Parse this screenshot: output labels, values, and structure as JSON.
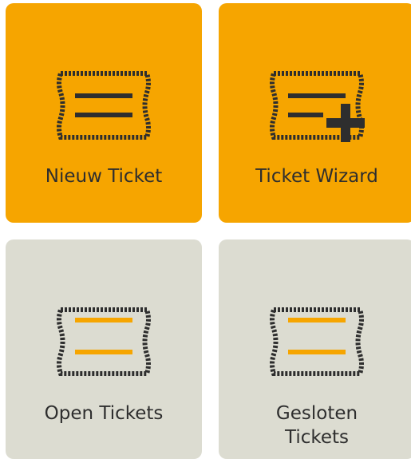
{
  "tiles": [
    {
      "label": "Nieuw Ticket",
      "icon": "ticket-icon",
      "color": "#f6a500"
    },
    {
      "label": "Ticket Wizard",
      "icon": "ticket-add-icon",
      "color": "#f6a500"
    },
    {
      "label": "Open Tickets",
      "icon": "ticket-icon",
      "color": "#dcdcd1"
    },
    {
      "label": "Gesloten Tickets",
      "label_line1": "Gesloten",
      "label_line2": "Tickets",
      "icon": "ticket-icon",
      "color": "#dcdcd1"
    }
  ],
  "colors": {
    "accent": "#f6a500",
    "neutral": "#dcdcd1",
    "icon_dark": "#2e2e2e"
  }
}
